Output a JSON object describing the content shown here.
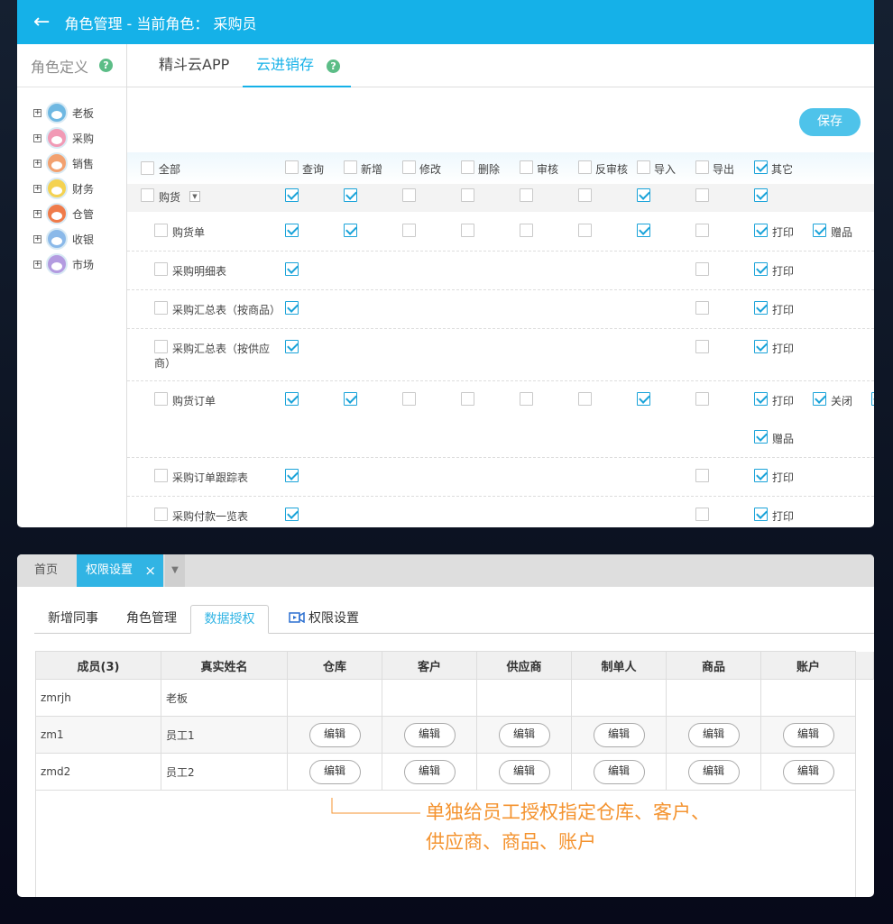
{
  "header": {
    "title": "角色管理 - 当前角色： 采购员"
  },
  "sidebar": {
    "title": "角色定义",
    "help": "?",
    "roles": [
      {
        "label": "老板",
        "color": "#6fb8e2"
      },
      {
        "label": "采购",
        "color": "#f19ab5"
      },
      {
        "label": "销售",
        "color": "#f2a170"
      },
      {
        "label": "财务",
        "color": "#f4d251"
      },
      {
        "label": "仓管",
        "color": "#ef7b4a"
      },
      {
        "label": "收银",
        "color": "#8bb9e9"
      },
      {
        "label": "市场",
        "color": "#b39be0"
      }
    ]
  },
  "tabs": [
    {
      "label": "精斗云APP"
    },
    {
      "label": "云进销存"
    }
  ],
  "tab_help": "?",
  "save_label": "保存",
  "perm_header": {
    "all": "全部",
    "cols": [
      "查询",
      "新增",
      "修改",
      "删除",
      "审核",
      "反审核",
      "导入",
      "导出",
      "其它"
    ],
    "checked": [
      false,
      false,
      false,
      false,
      false,
      false,
      false,
      false,
      true
    ]
  },
  "group": {
    "label": "购货",
    "checks": [
      true,
      true,
      false,
      false,
      false,
      false,
      true,
      false,
      true
    ]
  },
  "rows": [
    {
      "label": "购货单",
      "checks": [
        true,
        true,
        false,
        false,
        false,
        false,
        true,
        false
      ],
      "extras": [
        {
          "label": "打印",
          "on": true
        },
        {
          "label": "赠品",
          "on": true
        }
      ]
    },
    {
      "label": "采购明细表",
      "checks": [
        true,
        null,
        null,
        null,
        null,
        null,
        null,
        false
      ],
      "extras": [
        {
          "label": "打印",
          "on": true
        }
      ]
    },
    {
      "label": "采购汇总表（按商品）",
      "checks": [
        true,
        null,
        null,
        null,
        null,
        null,
        null,
        false
      ],
      "extras": [
        {
          "label": "打印",
          "on": true
        }
      ]
    },
    {
      "label": "采购汇总表（按供应",
      "label2": "商）",
      "checks": [
        true,
        null,
        null,
        null,
        null,
        null,
        null,
        false
      ],
      "extras": [
        {
          "label": "打印",
          "on": true
        }
      ]
    },
    {
      "label": "购货订单",
      "checks": [
        true,
        true,
        false,
        false,
        false,
        false,
        true,
        false
      ],
      "extras": [
        {
          "label": "打印",
          "on": true
        },
        {
          "label": "关闭",
          "on": true
        }
      ],
      "extras2": [
        {
          "label": "赠品",
          "on": true
        }
      ]
    },
    {
      "label": "采购订单跟踪表",
      "checks": [
        true,
        null,
        null,
        null,
        null,
        null,
        null,
        false
      ],
      "extras": [
        {
          "label": "打印",
          "on": true
        }
      ]
    },
    {
      "label": "采购付款一览表",
      "checks": [
        true,
        null,
        null,
        null,
        null,
        null,
        null,
        false
      ],
      "extras": [
        {
          "label": "打印",
          "on": true
        }
      ]
    }
  ],
  "bottom": {
    "tabbar": {
      "home": "首页",
      "active": "权限设置",
      "close": "×",
      "more": "▼"
    },
    "subtabs": [
      "新增同事",
      "角色管理",
      "数据授权",
      "权限设置"
    ],
    "table": {
      "headers": [
        "成员(3)",
        "真实姓名",
        "仓库",
        "客户",
        "供应商",
        "制单人",
        "商品",
        "账户"
      ],
      "rows": [
        {
          "user": "zmrjh",
          "name": "老板",
          "editable": false
        },
        {
          "user": "zm1",
          "name": "员工1",
          "editable": true
        },
        {
          "user": "zmd2",
          "name": "员工2",
          "editable": true
        }
      ],
      "edit_label": "编辑"
    },
    "note_line1": "单独给员工授权指定仓库、客户、",
    "note_line2": "供应商、商品、账户"
  }
}
